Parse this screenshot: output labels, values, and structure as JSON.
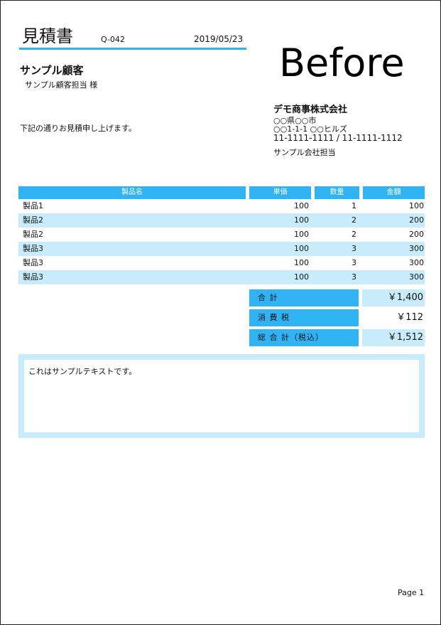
{
  "header": {
    "title": "見積書",
    "quote_no": "Q-042",
    "date": "2019/05/23",
    "watermark": "Before"
  },
  "client": {
    "name": "サンプル顧客",
    "contact": "サンプル顧客担当 様"
  },
  "intro": "下記の通りお見積申し上げます。",
  "company": {
    "name": "デモ商事株式会社",
    "address1": "○○県○○市",
    "address2": "○○1-1-1 ○○ヒルズ",
    "phone": "11-1111-1111 / 11-1111-1112",
    "contact": "サンプル会社担当"
  },
  "items": {
    "columns": [
      "製品名",
      "単価",
      "数量",
      "金額"
    ],
    "rows": [
      {
        "name": "製品1",
        "unit_price": "100",
        "qty": "1",
        "amount": "100"
      },
      {
        "name": "製品2",
        "unit_price": "100",
        "qty": "2",
        "amount": "200"
      },
      {
        "name": "製品2",
        "unit_price": "100",
        "qty": "2",
        "amount": "200"
      },
      {
        "name": "製品3",
        "unit_price": "100",
        "qty": "3",
        "amount": "300"
      },
      {
        "name": "製品3",
        "unit_price": "100",
        "qty": "3",
        "amount": "300"
      },
      {
        "name": "製品3",
        "unit_price": "100",
        "qty": "3",
        "amount": "300"
      }
    ]
  },
  "totals": [
    {
      "label": "合 計",
      "value": "￥1,400"
    },
    {
      "label": "消 費 税",
      "value": "￥112"
    },
    {
      "label": "総 合 計（税込）",
      "value": "￥1,512"
    }
  ],
  "notes": "これはサンプルテキストです。",
  "footer": {
    "page": "Page 1"
  },
  "colors": {
    "accent": "#2fb3f3",
    "light": "#c8ecfb"
  }
}
